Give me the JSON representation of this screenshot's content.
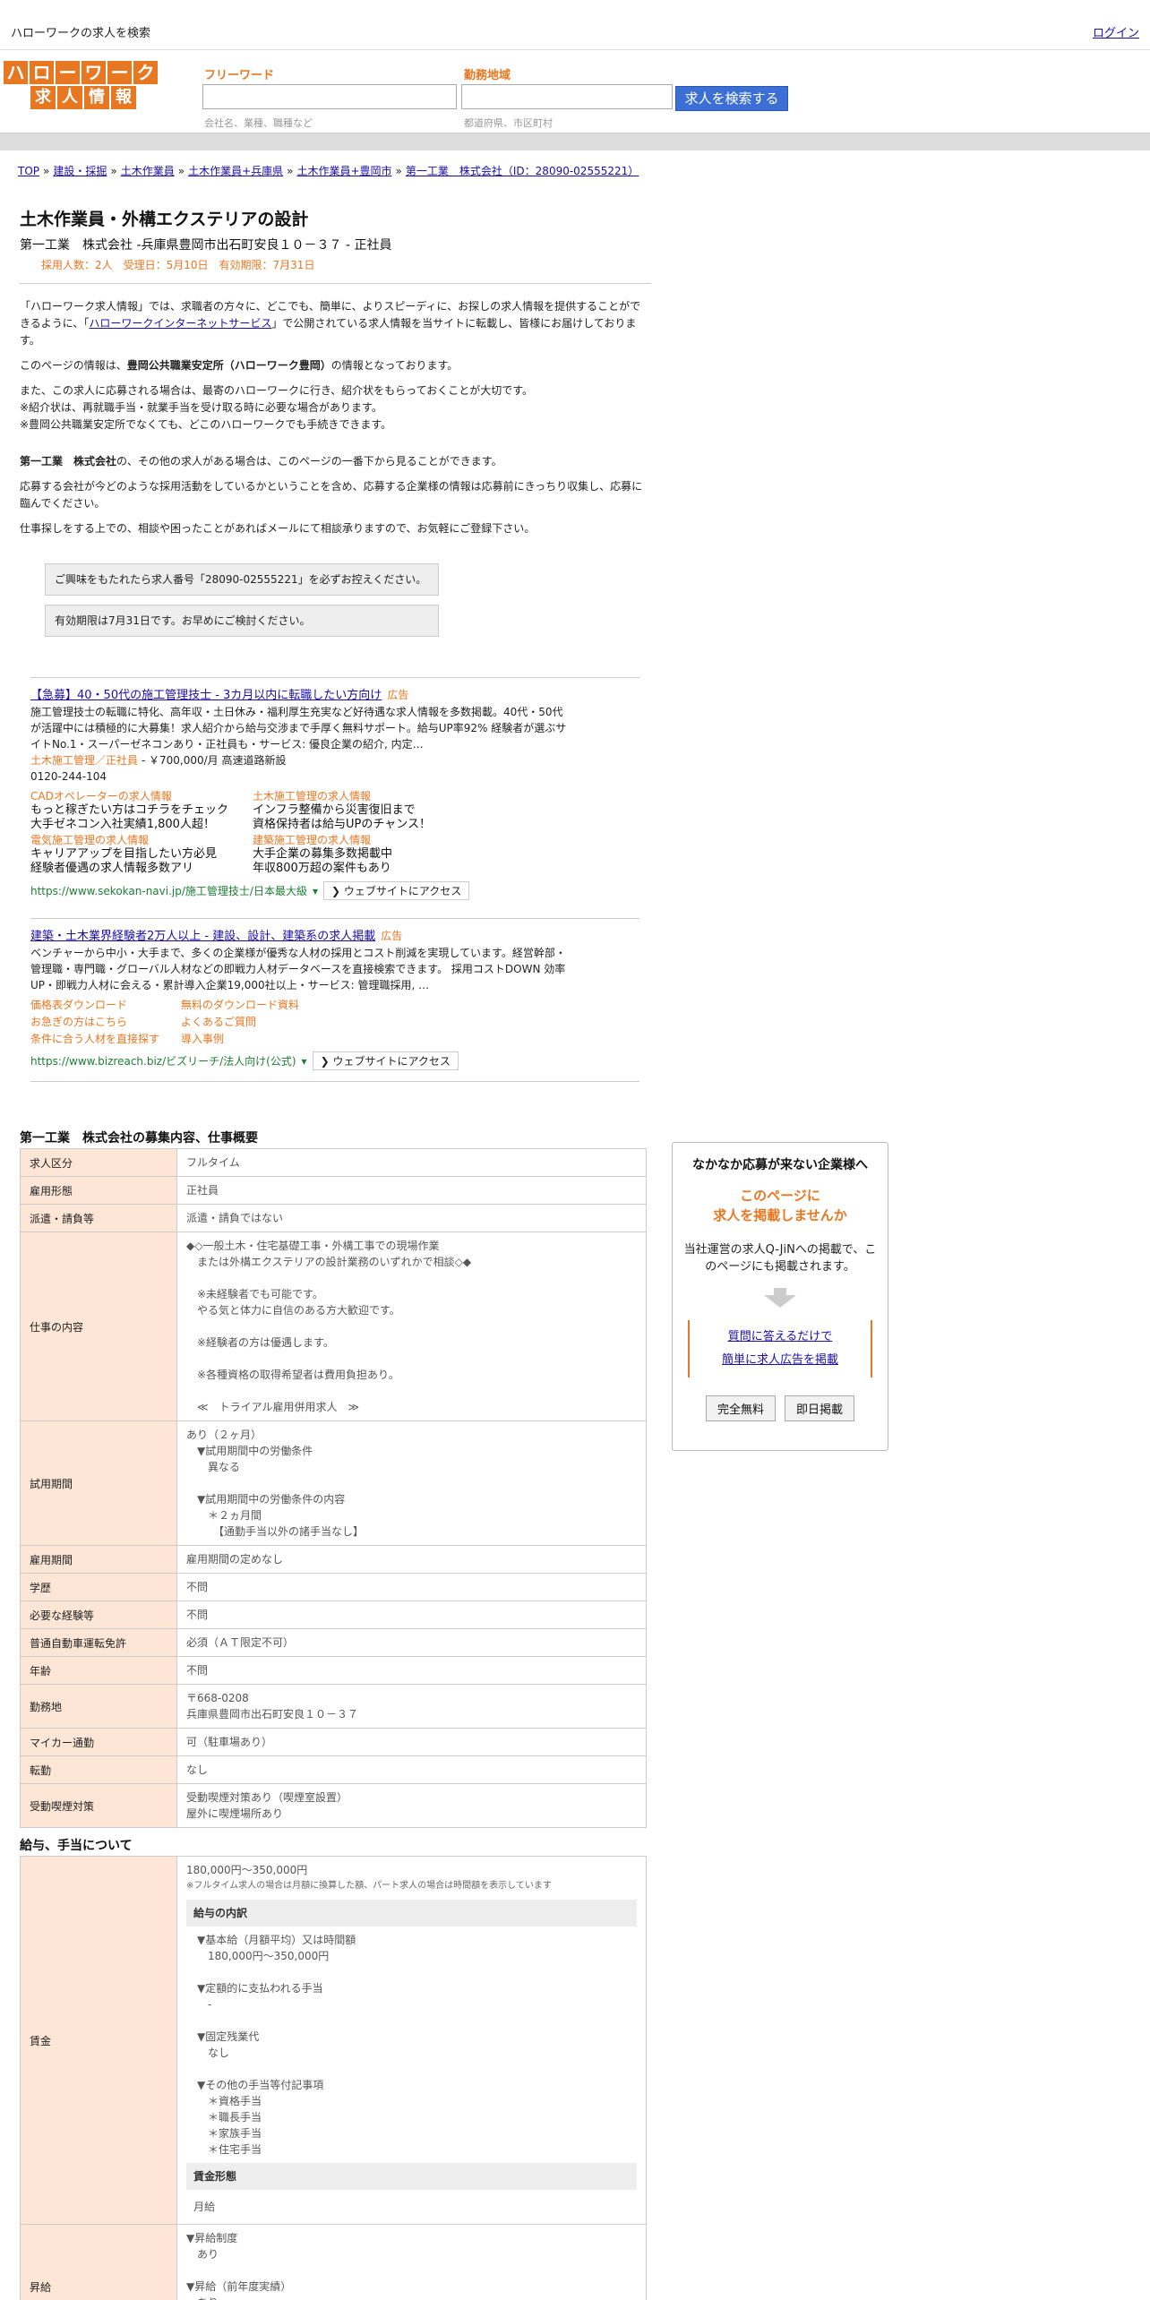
{
  "topbar": {
    "site_title": "ハローワークの求人を検索",
    "login": "ログイン"
  },
  "logo": {
    "row1": [
      "ハ",
      "ロ",
      "ー",
      "ワ",
      "ー",
      "ク"
    ],
    "row2": [
      "求",
      "人",
      "情",
      "報"
    ]
  },
  "search": {
    "freeword_label": "フリーワード",
    "freeword_hint": "会社名、業種、職種など",
    "area_label": "勤務地域",
    "area_hint": "都道府県、市区町村",
    "button": "求人を検索する"
  },
  "breadcrumb": [
    "TOP",
    "建設・採掘",
    "土木作業員",
    "土木作業員+兵庫県",
    "土木作業員+豊岡市",
    "第一工業　株式会社（ID：28090-02555221）"
  ],
  "job": {
    "title": "土木作業員・外構エクステリアの設計",
    "company_line": "第一工業　株式会社 -兵庫県豊岡市出石町安良１０－３７ - 正社員",
    "meta": "採用人数：2人　受理日：5月10日　有効期限：7月31日"
  },
  "intro": {
    "p1_a": "「ハローワーク求人情報」では、求職者の方々に、どこでも、簡単に、よりスピーディに、お探しの求人情報を提供することができるように、「",
    "p1_link": "ハローワークインターネットサービス",
    "p1_b": "」で公開されている求人情報を当サイトに転載し、皆様にお届けしております。",
    "p2_a": "このページの情報は、",
    "p2_bold": "豊岡公共職業安定所（ハローワーク豊岡）",
    "p2_b": "の情報となっております。",
    "p3": "また、この求人に応募される場合は、最寄のハローワークに行き、紹介状をもらっておくことが大切です。\n※紹介状は、再就職手当・就業手当を受け取る時に必要な場合があります。\n※豊岡公共職業安定所でなくても、どこのハローワークでも手続きできます。",
    "p4_bold": "第一工業　株式会社",
    "p4_b": "の、その他の求人がある場合は、このページの一番下から見ることができます。",
    "p5": "応募する会社が今どのような採用活動をしているかということを含め、応募する企業様の情報は応募前にきっちり収集し、応募に臨んでください。",
    "p6": "仕事探しをする上での、相談や困ったことがあればメールにて相談承りますので、お気軽にご登録下さい。",
    "notice1": "ご興味をもたれたら求人番号「28090-02555221」を必ずお控えください。",
    "notice2": "有効期限は7月31日です。お早めにご検討ください。"
  },
  "ads": {
    "ad1": {
      "title": "【急募】40・50代の施工管理技士 - 3カ月以内に転職したい方向け",
      "badge": "広告",
      "text": "施工管理技士の転職に特化、高年収・土日休み・福利厚生充実など好待遇な求人情報を多数掲載。40代・50代が活躍中には積極的に大募集！求人紹介から給与交渉まで手厚く無料サポート。給与UP率92% 経験者が選ぶサイトNo.1・スーパーゼネコンあり・正社員も・サービス: 優良企業の紹介, 内定…",
      "sub_orange": "土木施工管理／正社員",
      "sub_rest": " - ￥700,000/月 高速道路新設",
      "phone": "0120-244-104",
      "sitelinks": [
        {
          "title": "CADオペレーターの求人情報",
          "desc": "もっと稼ぎたい方はコチラをチェック\n大手ゼネコン入社実績1,800人超！"
        },
        {
          "title": "土木施工管理の求人情報",
          "desc": "インフラ整備から災害復旧まで\n資格保持者は給与UPのチャンス！"
        },
        {
          "title": "電気施工管理の求人情報",
          "desc": "キャリアアップを目指したい方必見\n経験者優遇の求人情報多数アリ"
        },
        {
          "title": "建築施工管理の求人情報",
          "desc": "大手企業の募集多数掲載中\n年収800万超の案件もあり"
        }
      ],
      "url": "https://www.sekokan-navi.jp/施工管理技士/日本最大級",
      "visit": "❯ ウェブサイトにアクセス"
    },
    "ad2": {
      "title": "建築・土木業界経験者2万人以上 - 建設、設計、建築系の求人掲載",
      "badge": "広告",
      "text": "ベンチャーから中小・大手まで、多くの企業様が優秀な人材の採用とコスト削減を実現しています。経営幹部・管理職・専門職・グローバル人材などの即戦力人材データベースを直接検索できます。 採用コストDOWN 効率UP・即戦力人材に会える・累計導入企業19,000社以上・サービス: 管理職採用, …",
      "sitelinks": [
        "価格表ダウンロード",
        "無料のダウンロード資料",
        "お急ぎの方はこちら",
        "よくあるご質問",
        "条件に合う人材を直接探す",
        "導入事例"
      ],
      "url": "https://www.bizreach.biz/ビズリーチ/法人向け(公式)",
      "visit": "❯ ウェブサイトにアクセス"
    }
  },
  "overview": {
    "title": "第一工業　株式会社の募集内容、仕事概要",
    "rows": [
      {
        "label": "求人区分",
        "value": "フルタイム"
      },
      {
        "label": "雇用形態",
        "value": "正社員"
      },
      {
        "label": "派遣・請負等",
        "value": "派遣・請負ではない"
      },
      {
        "label": "仕事の内容",
        "value": "◆◇一般土木・住宅基礎工事・外構工事での現場作業\n　または外構エクステリアの設計業務のいずれかで相談◇◆\n\n　※未経験者でも可能です。\n　やる気と体力に自信のある方大歓迎です。\n\n　※経験者の方は優遇します。\n\n　※各種資格の取得希望者は費用負担あり。\n\n　≪　トライアル雇用併用求人　≫"
      },
      {
        "label": "試用期間",
        "value": "あり（２ヶ月）\n　▼試用期間中の労働条件\n　　異なる\n\n　▼試用期間中の労働条件の内容\n　　＊２ヵ月間\n　　　【通勤手当以外の諸手当なし】"
      },
      {
        "label": "雇用期間",
        "value": "雇用期間の定めなし"
      },
      {
        "label": "学歴",
        "value": "不問"
      },
      {
        "label": "必要な経験等",
        "value": "不問"
      },
      {
        "label": "普通自動車運転免許",
        "value": "必須（ＡＴ限定不可）"
      },
      {
        "label": "年齢",
        "value": "不問"
      },
      {
        "label": "勤務地",
        "value": "〒668-0208\n兵庫県豊岡市出石町安良１０－３７"
      },
      {
        "label": "マイカー通勤",
        "value": "可（駐車場あり）"
      },
      {
        "label": "転勤",
        "value": "なし"
      },
      {
        "label": "受動喫煙対策",
        "value": "受動喫煙対策あり（喫煙室設置）\n屋外に喫煙場所あり"
      }
    ]
  },
  "salary": {
    "title": "給与、手当について",
    "wage_label": "賃金",
    "wage_range": "180,000円〜350,000円",
    "wage_note": "※フルタイム求人の場合は月額に換算した額、パート求人の場合は時間額を表示しています",
    "breakdown_head": "給与の内訳",
    "breakdown": "　▼基本給（月額平均）又は時間額\n　　180,000円〜350,000円\n\n　▼定額的に支払われる手当\n　　-\n\n　▼固定残業代\n　　なし\n\n　▼その他の手当等付記事項\n　　＊資格手当\n　　＊職長手当\n　　＊家族手当\n　　＊住宅手当",
    "form_head": "賃金形態",
    "form_value": "月給",
    "raise_label": "昇給",
    "raise_value": "▼昇給制度\n　あり\n\n▼昇給（前年度実績）\n　あり\n\n▼昇給金額／昇給率"
  },
  "side": {
    "title": "なかなか応募が来ない企業様へ",
    "orange1": "このページに",
    "orange2": "求人を掲載しませんか",
    "text": "当社運営の求人Q-JiNへの掲載で、このページにも掲載されます。",
    "link1": "質問に答えるだけで",
    "link2": "簡単に求人広告を掲載",
    "btn1": "完全無料",
    "btn2": "即日掲載"
  }
}
